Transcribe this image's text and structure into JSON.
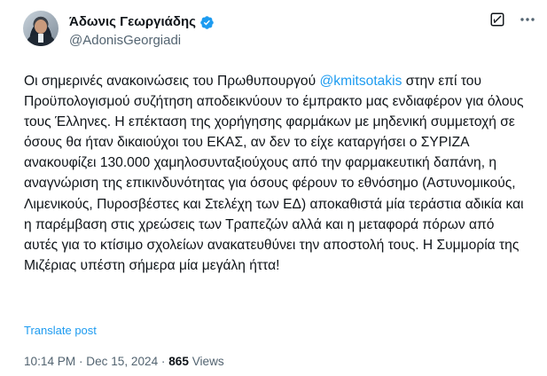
{
  "author": {
    "display_name": "Άδωνις Γεωργιάδης",
    "handle": "@AdonisGeorgiadi",
    "verified_icon": "verified-badge-icon",
    "avatar": "profile-photo"
  },
  "header_actions": {
    "grok_icon": "grok-icon",
    "more_icon": "more-horizontal-icon"
  },
  "post": {
    "text_before_mention": "Οι σημερινές ανακοινώσεις του Πρωθυπουργού ",
    "mention": "@kmitsotakis",
    "text_after_mention": " στην επί του Προϋπολογισμού συζήτηση αποδεικνύουν το έμπρακτο μας ενδιαφέρον για όλους τους Έλληνες. Η επέκταση της χορήγησης φαρμάκων με μηδενική συμμετοχή σε όσους θα ήταν δικαιούχοι του ΕΚΑΣ, αν δεν το είχε καταργήσει ο ΣΥΡΙΖΑ ανακουφίζει 130.000 χαμηλοσυνταξιούχους από την φαρμακευτική δαπάνη, η αναγνώριση της επικινδυνότητας για όσους φέρουν το εθνόσημο (Αστυνομικούς, Λιμενικούς, Πυροσβέστες και Στελέχη των ΕΔ) αποκαθιστά μία τεράστια αδικία και η παρέμβαση στις χρεώσεις των Τραπεζών αλλά και η μεταφορά πόρων από αυτές για το κτίσιμο σχολείων ανακατευθύνει την αποστολή τους. Η Συμμορία της Μιζέριας υπέστη σήμερα μία μεγάλη ήττα!",
    "translate_label": "Translate post"
  },
  "meta": {
    "time": "10:14 PM",
    "separator": " · ",
    "date": "Dec 15, 2024",
    "views_count": "865",
    "views_label": " Views"
  },
  "colors": {
    "accent": "#1d9bf0",
    "text_primary": "#0f1419",
    "text_secondary": "#536471"
  }
}
